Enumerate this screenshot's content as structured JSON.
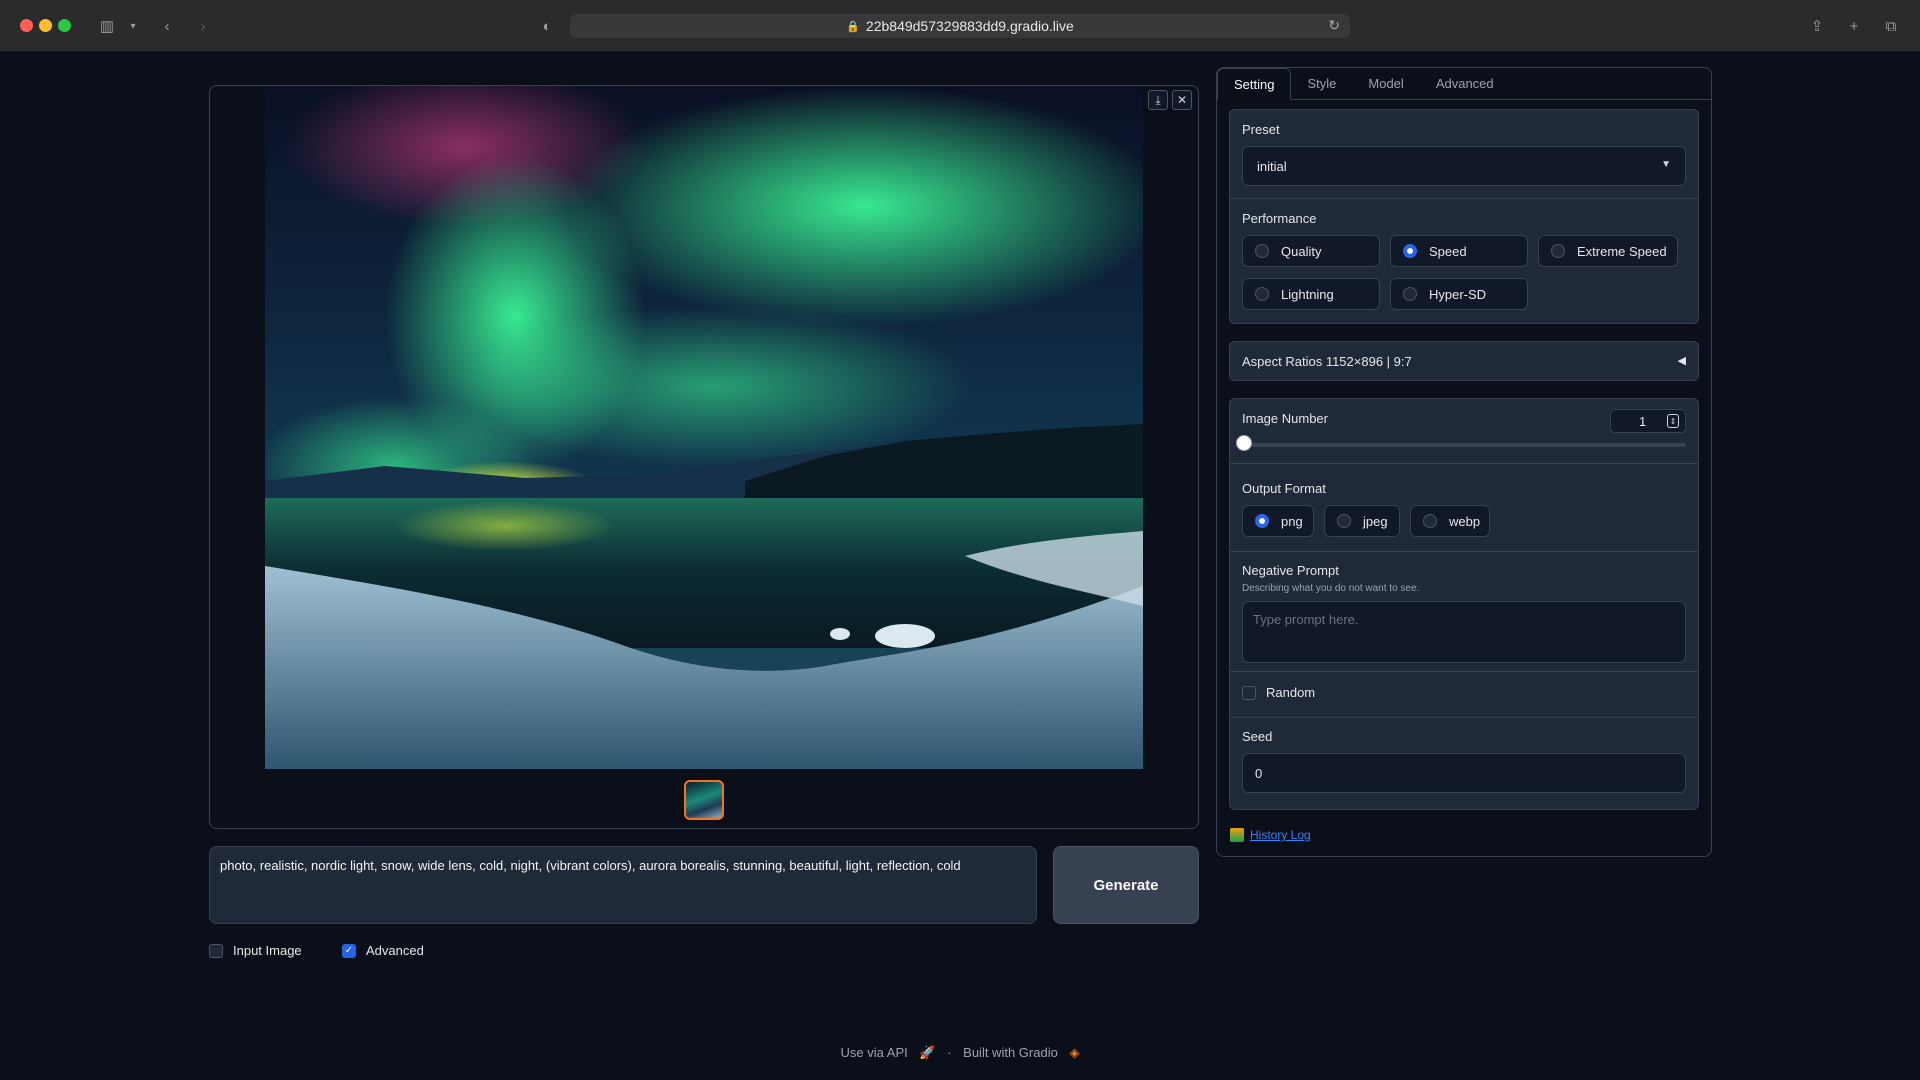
{
  "browser": {
    "url": "22b849d57329883dd9.gradio.live"
  },
  "gallery": {
    "download_icon": "download-icon",
    "close_icon": "close-icon"
  },
  "prompt": {
    "value": "photo, realistic, nordic light, snow, wide lens, cold, night, (vibrant colors), aurora borealis, stunning, beautiful, light, reflection, cold"
  },
  "generate_label": "Generate",
  "checkboxes": {
    "input_image": {
      "label": "Input Image",
      "checked": false
    },
    "advanced": {
      "label": "Advanced",
      "checked": true
    }
  },
  "tabs": [
    "Setting",
    "Style",
    "Model",
    "Advanced"
  ],
  "preset": {
    "label": "Preset",
    "value": "initial"
  },
  "performance": {
    "label": "Performance",
    "options": [
      "Quality",
      "Speed",
      "Extreme Speed",
      "Lightning",
      "Hyper-SD"
    ],
    "selected": "Speed"
  },
  "aspect_ratios": {
    "label": "Aspect Ratios 1152×896 | 9:7"
  },
  "image_number": {
    "label": "Image Number",
    "value": "1"
  },
  "output_format": {
    "label": "Output Format",
    "options": [
      "png",
      "jpeg",
      "webp"
    ],
    "selected": "png"
  },
  "negative_prompt": {
    "label": "Negative Prompt",
    "description": "Describing what you do not want to see.",
    "placeholder": "Type prompt here."
  },
  "random": {
    "label": "Random",
    "checked": false
  },
  "seed": {
    "label": "Seed",
    "value": "0"
  },
  "history_log": "History Log",
  "footer": {
    "api": "Use via API",
    "separator": "·",
    "built": "Built with Gradio"
  },
  "colors": {
    "accent": "#2563eb",
    "thumb_border": "#f97316",
    "background": "#0b0f19"
  }
}
